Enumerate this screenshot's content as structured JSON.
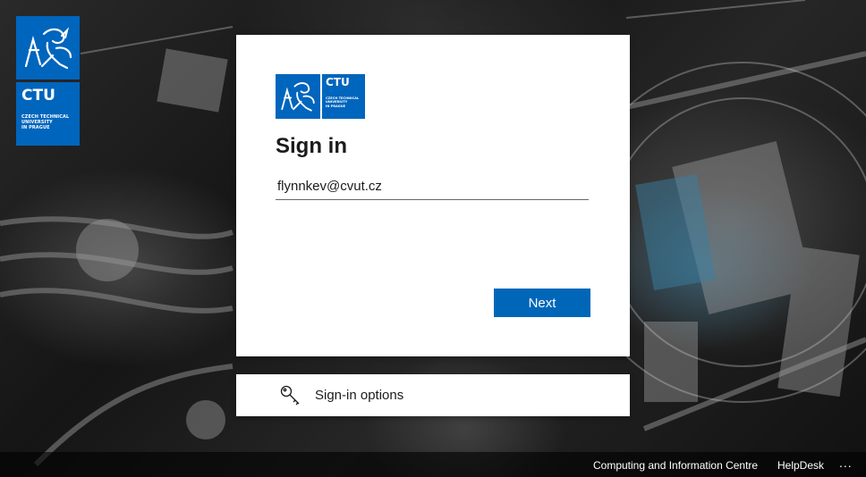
{
  "brand": {
    "logo_word": "CTU",
    "logo_subtitle": "CZECH TECHNICAL\nUNIVERSITY\nIN PRAGUE",
    "color": "#0065bd"
  },
  "signin": {
    "title": "Sign in",
    "email_value": "flynnkev@cvut.cz",
    "next_label": "Next"
  },
  "options": {
    "label": "Sign-in options",
    "icon": "key-icon"
  },
  "footer": {
    "links": [
      "Computing and Information Centre",
      "HelpDesk"
    ],
    "more_label": "..."
  },
  "colors": {
    "primary_button": "#0067b8",
    "card_background": "#ffffff"
  }
}
